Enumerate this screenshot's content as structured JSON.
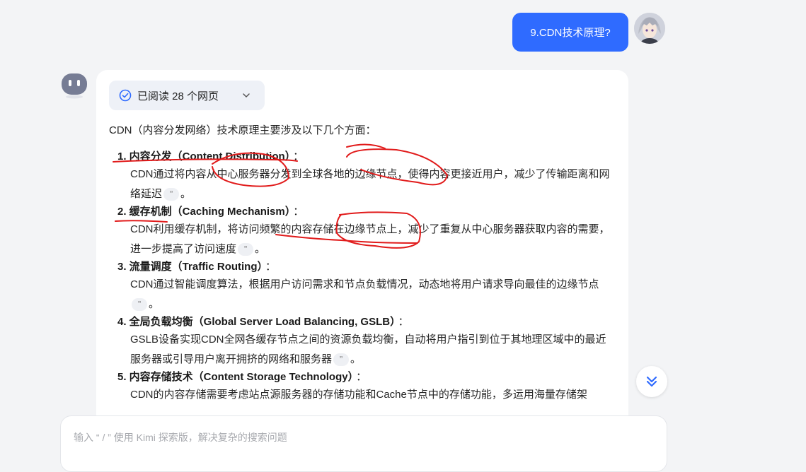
{
  "user_message": {
    "text": "9.CDN技术原理?"
  },
  "answer": {
    "read_pages_label": "已阅读 28 个网页",
    "intro": "CDN（内容分发网络）技术原理主要涉及以下几个方面：",
    "items": [
      {
        "title": "1. 内容分发（Content Distribution）",
        "colon": "：",
        "body": "CDN通过将内容从中心服务器分发到全球各地的边缘节点，使得内容更接近用户，减少了传输距离和网络延迟",
        "end": "。"
      },
      {
        "title": "2. 缓存机制（Caching Mechanism）",
        "colon": "：",
        "body": "CDN利用缓存机制，将访问频繁的内容存储在边缘节点上，减少了重复从中心服务器获取内容的需要，进一步提高了访问速度",
        "end": "。"
      },
      {
        "title": "3. 流量调度（Traffic Routing）",
        "colon": "：",
        "body": "CDN通过智能调度算法，根据用户访问需求和节点负载情况，动态地将用户请求导向最佳的边缘节点",
        "end": "。"
      },
      {
        "title": "4. 全局负载均衡（Global Server Load Balancing, GSLB）",
        "colon": "：",
        "body": "GSLB设备实现CDN全网各缓存节点之间的资源负载均衡，自动将用户指引到位于其地理区域中的最近服务器或引导用户离开拥挤的网络和服务器",
        "end": "。"
      },
      {
        "title": "5. 内容存储技术（Content Storage Technology）",
        "colon": "：",
        "body": "CDN的内容存储需要考虑站点源服务器的存储功能和Cache节点中的存储功能，多运用海量存储架",
        "end": ""
      }
    ],
    "citation_glyph": "”"
  },
  "input": {
    "placeholder": "输入 “ / ” 使用 Kimi 探索版，解决复杂的搜索问题"
  },
  "icons": {
    "read_status": "check-circle-icon",
    "expand": "chevron-down-icon",
    "scroll": "double-chevron-down-icon",
    "bot": "kimi-bot-avatar",
    "user": "anime-avatar"
  },
  "colors": {
    "accent": "#2f6bff",
    "annotation_ink": "#e11b1b",
    "card_bg": "#ffffff",
    "page_bg": "#f3f4f6"
  }
}
